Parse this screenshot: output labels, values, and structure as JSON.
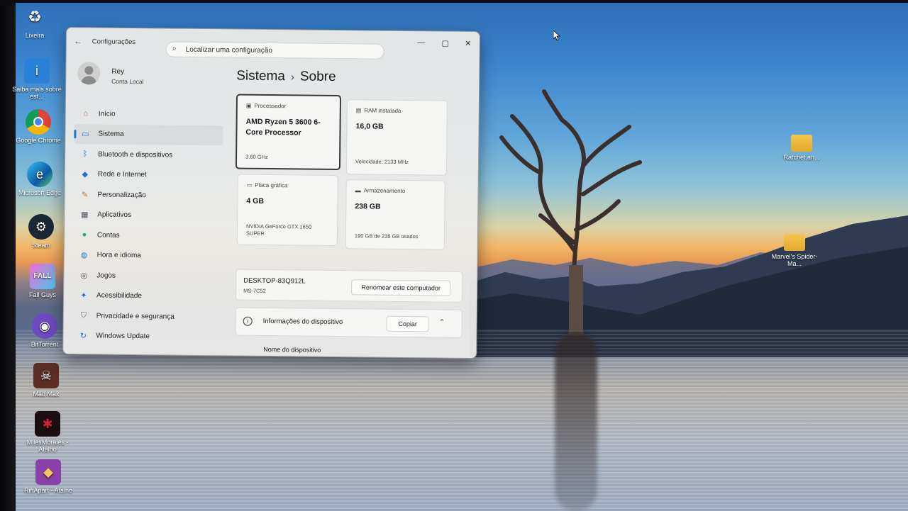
{
  "desktop": {
    "icons": [
      {
        "label": "Lixeira",
        "icon": "recycle-bin-icon"
      },
      {
        "label": "Saiba mais sobre est...",
        "icon": "info-icon"
      },
      {
        "label": "Google Chrome",
        "icon": "chrome-icon"
      },
      {
        "label": "Microsoft Edge",
        "icon": "edge-icon"
      },
      {
        "label": "Steam",
        "icon": "steam-icon"
      },
      {
        "label": "Fall Guys",
        "icon": "fall-guys-icon"
      },
      {
        "label": "BitTorrent",
        "icon": "bittorrent-icon"
      },
      {
        "label": "Mad Max",
        "icon": "mad-max-icon"
      },
      {
        "label": "MilesMorales - Atalho",
        "icon": "spider-icon"
      },
      {
        "label": "RiftApart - Atalho",
        "icon": "ratchet-icon"
      },
      {
        "label": "Ratchet.an...",
        "icon": "folder-icon"
      },
      {
        "label": "Marvel's Spider-Ma...",
        "icon": "folder-icon"
      }
    ]
  },
  "window": {
    "app_title": "Configurações",
    "back_icon": "back-arrow-icon",
    "search_placeholder": "Localizar uma configuração",
    "controls": {
      "minimize": "—",
      "maximize": "▢",
      "close": "✕"
    }
  },
  "profile": {
    "name": "Rey",
    "account_type": "Conta Local"
  },
  "nav": {
    "items": [
      {
        "label": "Início",
        "icon": "home-icon",
        "active": false
      },
      {
        "label": "Sistema",
        "icon": "system-monitor-icon",
        "active": true
      },
      {
        "label": "Bluetooth e dispositivos",
        "icon": "bluetooth-icon",
        "active": false
      },
      {
        "label": "Rede e Internet",
        "icon": "wifi-icon",
        "active": false
      },
      {
        "label": "Personalização",
        "icon": "brush-icon",
        "active": false
      },
      {
        "label": "Aplicativos",
        "icon": "apps-icon",
        "active": false
      },
      {
        "label": "Contas",
        "icon": "account-icon",
        "active": false
      },
      {
        "label": "Hora e idioma",
        "icon": "globe-clock-icon",
        "active": false
      },
      {
        "label": "Jogos",
        "icon": "gamepad-icon",
        "active": false
      },
      {
        "label": "Acessibilidade",
        "icon": "accessibility-icon",
        "active": false
      },
      {
        "label": "Privacidade e segurança",
        "icon": "shield-icon",
        "active": false
      },
      {
        "label": "Windows Update",
        "icon": "update-icon",
        "active": false
      }
    ]
  },
  "breadcrumb": {
    "parent": "Sistema",
    "separator": "›",
    "current": "Sobre"
  },
  "specs": {
    "processor": {
      "title": "Processador",
      "value": "AMD Ryzen 5 3600 6-Core Processor",
      "sub": "3.60 GHz"
    },
    "ram": {
      "title": "RAM instalada",
      "value": "16,0 GB",
      "sub": "Velocidade: 2133 MHz"
    },
    "gpu": {
      "title": "Placa gráfica",
      "value": "4 GB",
      "sub": "NVIDIA GeForce GTX 1650 SUPER"
    },
    "storage": {
      "title": "Armazenamento",
      "value": "238 GB",
      "sub": "190 GB de 238 GB usados"
    }
  },
  "device": {
    "name": "DESKTOP-83Q912L",
    "model": "MS-7C52",
    "rename_button": "Renomear este computador",
    "info_title": "Informações do dispositivo",
    "copy_button": "Copiar",
    "device_name_label": "Nome do dispositivo"
  },
  "colors": {
    "accent": "#1f6fd0",
    "window_bg": "#eaeae8"
  }
}
